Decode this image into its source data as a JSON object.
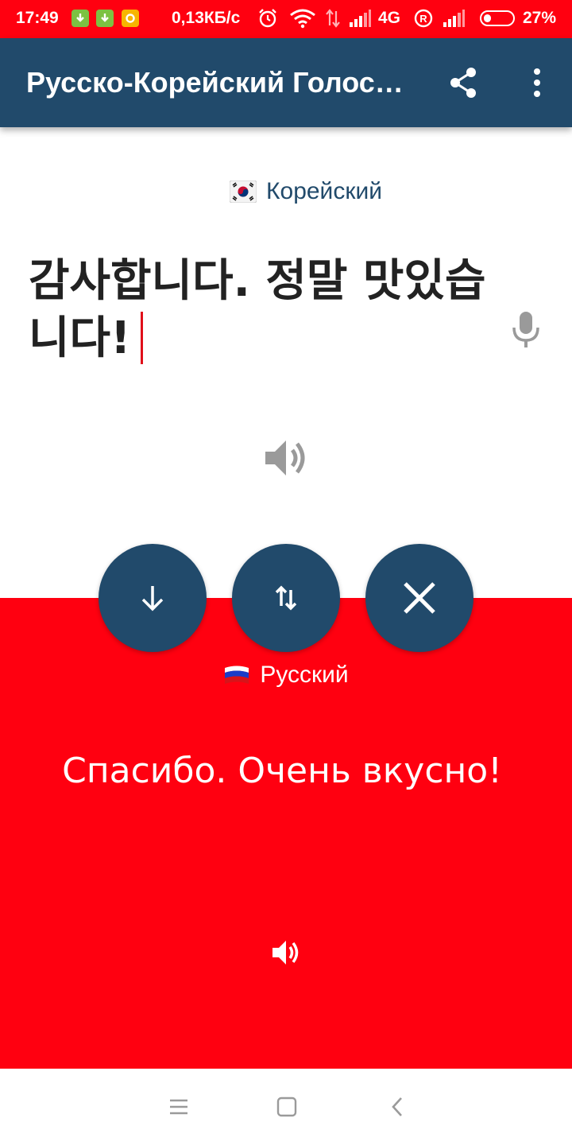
{
  "status_bar": {
    "time": "17:49",
    "speed": "0,13КБ/с",
    "network": "4G",
    "battery_percent": "27%",
    "battery_level": 0.27,
    "color": "#ff0010"
  },
  "app_bar": {
    "title": "Русско-Корейский Голосовой Переводчик",
    "share_icon": "share-icon",
    "more_icon": "more-vert-icon",
    "color": "#214a6b"
  },
  "source": {
    "language": "Корейский",
    "flag": "south-korea-flag-icon",
    "text": "감사합니다. 정말 맛있습니다!",
    "mic_icon": "microphone-icon",
    "speaker_icon": "speaker-icon"
  },
  "actions": {
    "download_icon": "arrow-down-icon",
    "swap_icon": "swap-vertical-icon",
    "clear_icon": "close-icon"
  },
  "target": {
    "language": "Русский",
    "flag": "russia-flag-icon",
    "text": "Спасибо. Очень вкусно!",
    "speaker_icon": "speaker-icon",
    "color": "#ff0010"
  },
  "nav_bar": {
    "menu_icon": "menu-icon",
    "home_icon": "home-icon",
    "back_icon": "back-icon"
  }
}
